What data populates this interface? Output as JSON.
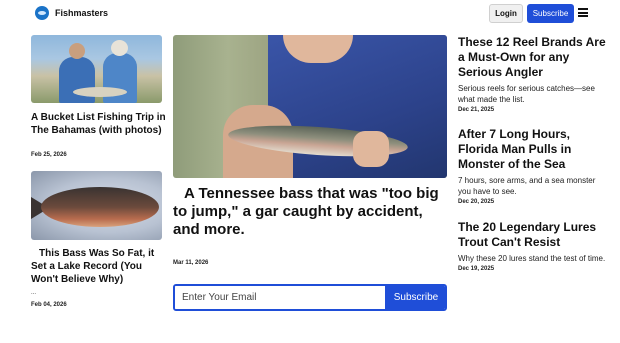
{
  "header": {
    "brand": "Fishmasters",
    "login_label": "Login",
    "subscribe_label": "Subscribe"
  },
  "left": {
    "articles": [
      {
        "title": "A Bucket List Fishing Trip in The Bahamas (with photos)",
        "date": "Feb 25, 2026"
      },
      {
        "title": "This Bass Was So Fat, it Set a Lake Record (You Won't Believe Why)",
        "extra": "...",
        "date": "Feb 04, 2026"
      }
    ]
  },
  "center": {
    "title": "A Tennessee bass that was \"too big to jump,\" a gar caught by accident, and more.",
    "date": "Mar 11, 2026",
    "newsletter": {
      "placeholder": "Enter Your Email",
      "button_label": "Subscribe"
    }
  },
  "right": {
    "articles": [
      {
        "title": "These 12 Reel Brands Are a Must-Own for any Serious Angler",
        "subtitle": "Serious reels for serious catches—see what made the list.",
        "date": "Dec 21, 2025"
      },
      {
        "title": "After 7 Long Hours, Florida Man Pulls in Monster of the Sea",
        "subtitle": "7 hours, sore arms, and a sea monster you have to see.",
        "date": "Dec 20, 2025"
      },
      {
        "title": "The 20 Legendary Lures Trout Can't Resist",
        "subtitle": "Why these 20 lures stand the test of time.",
        "date": "Dec 19, 2025"
      }
    ]
  },
  "colors": {
    "accent": "#1f4ed8",
    "logo": "#1a73c8"
  },
  "icons": {
    "logo": "fish-logo-icon",
    "menu": "hamburger-menu-icon"
  }
}
